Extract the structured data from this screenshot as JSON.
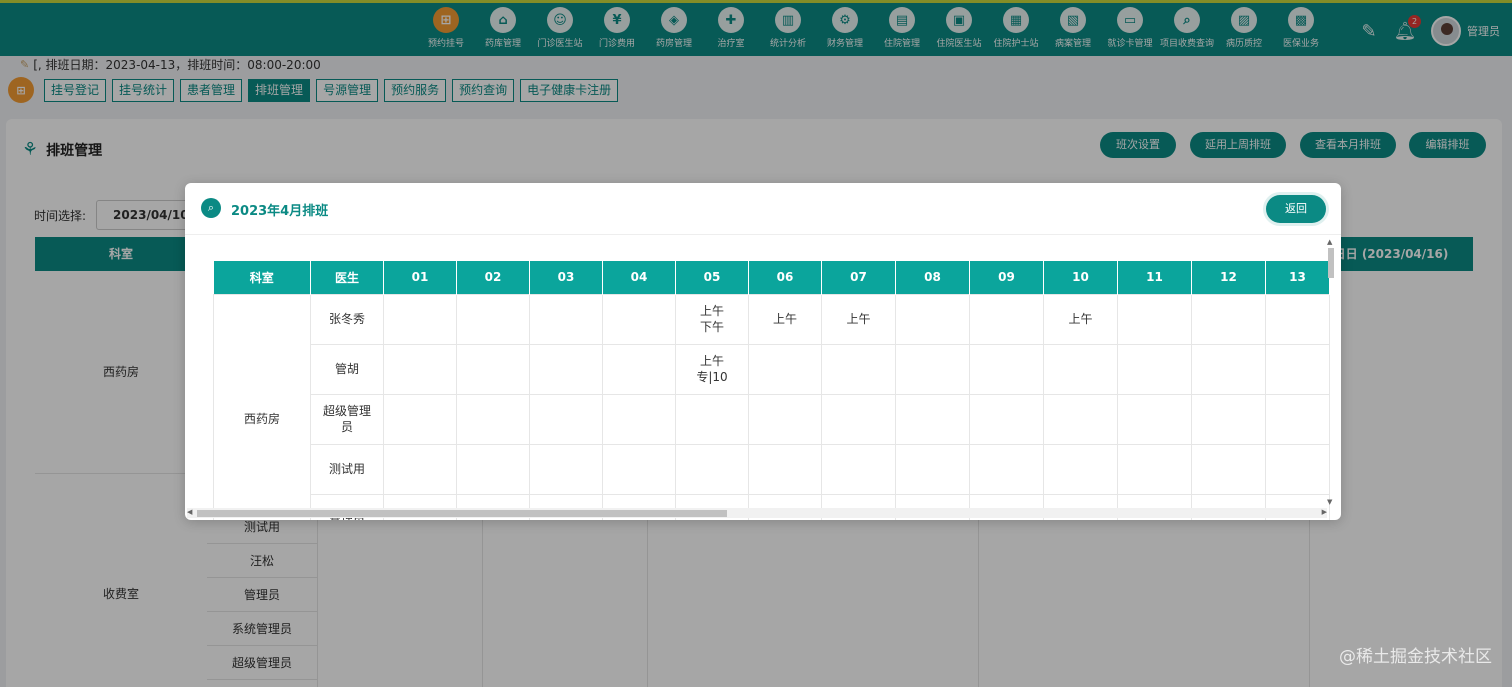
{
  "nav": [
    {
      "label": "预约挂号",
      "icon": "calendar-icon",
      "glyph": "⊞",
      "active": true
    },
    {
      "label": "药库管理",
      "icon": "home-icon",
      "glyph": "⌂"
    },
    {
      "label": "门诊医生站",
      "icon": "doctor-icon",
      "glyph": "☺"
    },
    {
      "label": "门诊费用",
      "icon": "yen-icon",
      "glyph": "¥"
    },
    {
      "label": "药房管理",
      "icon": "pill-icon",
      "glyph": "◈"
    },
    {
      "label": "治疗室",
      "icon": "nurse-icon",
      "glyph": "✚"
    },
    {
      "label": "统计分析",
      "icon": "bar-chart-icon",
      "glyph": "▥"
    },
    {
      "label": "财务管理",
      "icon": "gear-icon",
      "glyph": "⚙"
    },
    {
      "label": "住院管理",
      "icon": "bed-icon",
      "glyph": "▤"
    },
    {
      "label": "住院医生站",
      "icon": "id-card-icon",
      "glyph": "▣"
    },
    {
      "label": "住院护士站",
      "icon": "bed-nurse-icon",
      "glyph": "▦"
    },
    {
      "label": "病案管理",
      "icon": "folder-icon",
      "glyph": "▧"
    },
    {
      "label": "就诊卡管理",
      "icon": "card-icon",
      "glyph": "▭"
    },
    {
      "label": "项目收费查询",
      "icon": "search-doc-icon",
      "glyph": "⌕"
    },
    {
      "label": "病历质控",
      "icon": "record-icon",
      "glyph": "▨"
    },
    {
      "label": "医保业务",
      "icon": "insurance-card-icon",
      "glyph": "▩"
    }
  ],
  "header": {
    "bell_count": "2",
    "username": "管理员"
  },
  "info": {
    "text": "[, 排班日期：2023-04-13，排班时间：08:00-20:00"
  },
  "tabs": [
    {
      "label": "挂号登记"
    },
    {
      "label": "挂号统计"
    },
    {
      "label": "患者管理"
    },
    {
      "label": "排班管理",
      "active": true
    },
    {
      "label": "号源管理"
    },
    {
      "label": "预约服务"
    },
    {
      "label": "预约查询"
    },
    {
      "label": "电子健康卡注册"
    }
  ],
  "page": {
    "title": "排班管理",
    "buttons": {
      "shift_settings": "班次设置",
      "extend_last_week": "延用上周排班",
      "view_month": "查看本月排班",
      "edit": "编辑排班"
    },
    "date_label": "时间选择:",
    "date_value": "2023/04/10",
    "col_dept": "科室",
    "col_sunday": "日日 (2023/04/16)",
    "rows": [
      {
        "dept": "西药房",
        "doctors": []
      },
      {
        "dept": "收费室",
        "doctors": [
          "测试用",
          "汪松",
          "管理员",
          "系统管理员",
          "超级管理员"
        ]
      }
    ]
  },
  "modal": {
    "title": "2023年4月排班",
    "back": "返回",
    "columns": [
      "科室",
      "医生",
      "01",
      "02",
      "03",
      "04",
      "05",
      "06",
      "07",
      "08",
      "09",
      "10",
      "11",
      "12",
      "13"
    ],
    "dept": "西药房",
    "rows": [
      {
        "doctor": "张冬秀",
        "cells": [
          "",
          "",
          "",
          "",
          "上午\n下午",
          "上午",
          "上午",
          "",
          "",
          "上午",
          "",
          "",
          ""
        ]
      },
      {
        "doctor": "管胡",
        "cells": [
          "",
          "",
          "",
          "",
          "上午\n专|10",
          "",
          "",
          "",
          "",
          "",
          "",
          "",
          ""
        ]
      },
      {
        "doctor": "超级管理员",
        "cells": [
          "",
          "",
          "",
          "",
          "",
          "",
          "",
          "",
          "",
          "",
          "",
          "",
          ""
        ]
      },
      {
        "doctor": "测试用",
        "cells": [
          "",
          "",
          "",
          "",
          "",
          "",
          "",
          "",
          "",
          "",
          "",
          "",
          ""
        ]
      },
      {
        "doctor": "管理员",
        "cells": [
          "",
          "",
          "",
          "",
          "",
          "",
          "",
          "",
          "",
          "",
          "",
          "",
          ""
        ]
      }
    ]
  },
  "watermark": "@稀土掘金技术社区"
}
